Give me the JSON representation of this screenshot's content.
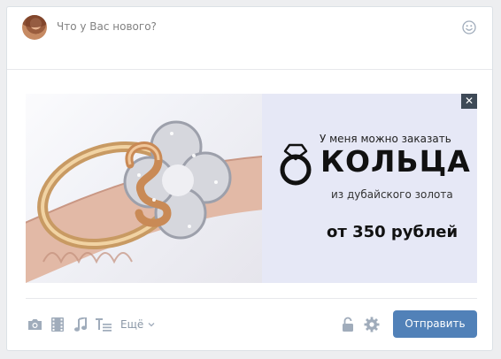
{
  "composer": {
    "placeholder": "Что у Вас нового?",
    "avatar_icon": "user-avatar",
    "emoji_icon": "smile-icon"
  },
  "ad": {
    "line1": "У меня можно заказать",
    "headline": "КОЛЬЦА",
    "line2": "из дубайского золота",
    "price": "от 350 рублей",
    "close_label": "✕",
    "colors": {
      "background": "#e6e8f6",
      "text": "#111111"
    }
  },
  "toolbar": {
    "icons": [
      "camera-icon",
      "video-icon",
      "music-icon",
      "text-format-icon"
    ],
    "more_label": "Ещё",
    "lock_icon": "lock-icon",
    "settings_icon": "gear-icon",
    "send_label": "Отправить",
    "colors": {
      "icon": "#a0acbb",
      "accent": "#5181b8"
    }
  }
}
